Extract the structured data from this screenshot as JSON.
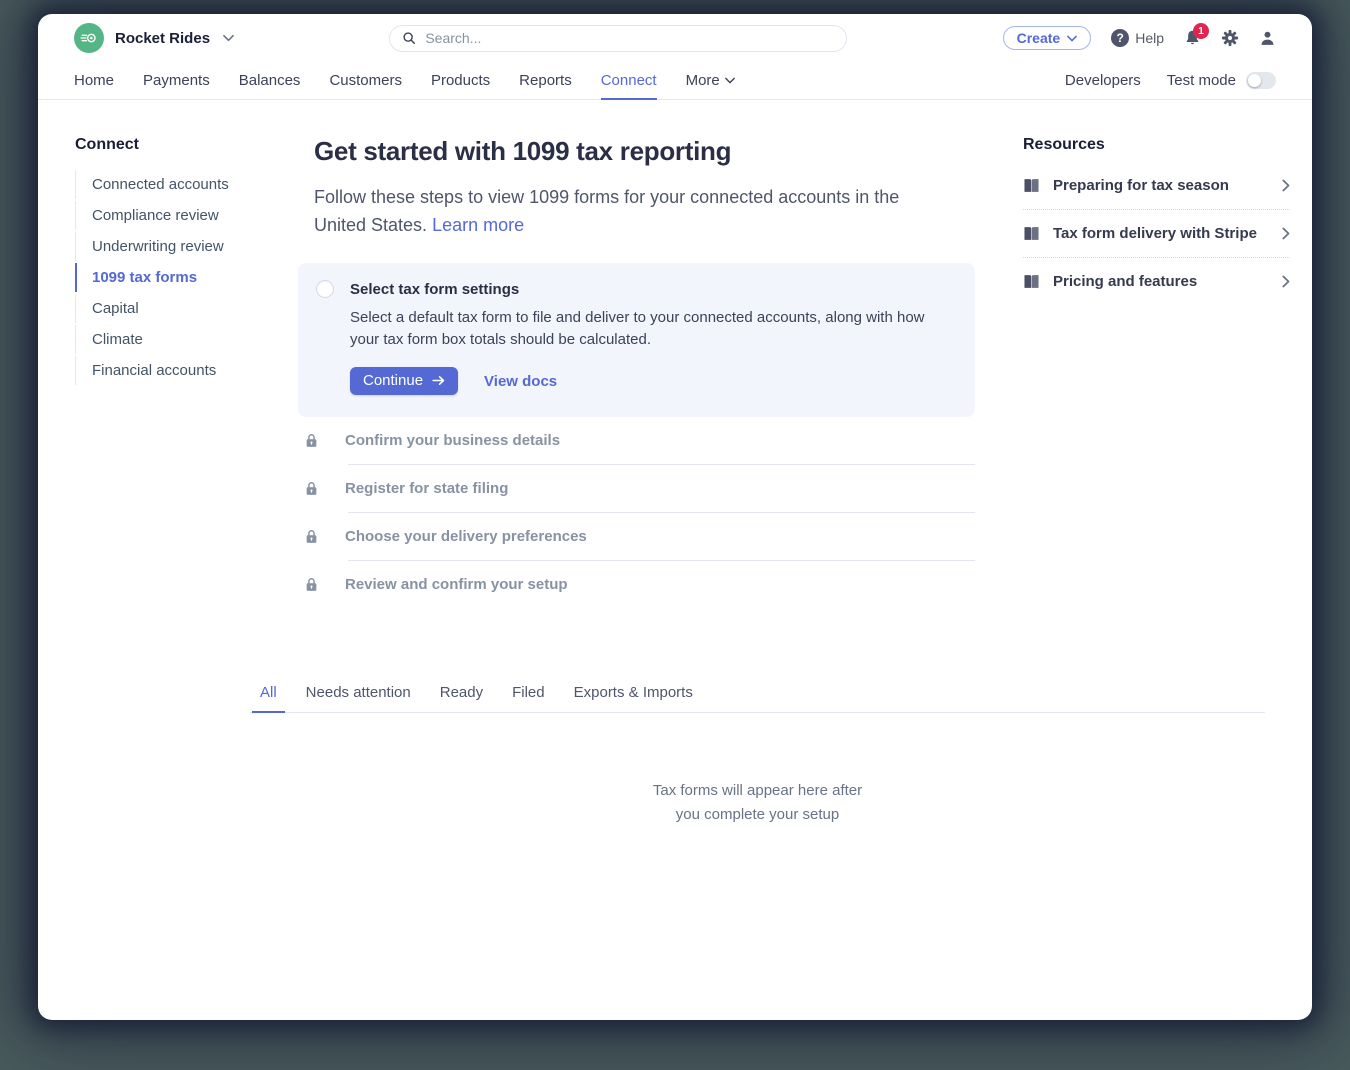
{
  "topbar": {
    "account_name": "Rocket Rides",
    "search_placeholder": "Search...",
    "create_label": "Create",
    "help_label": "Help",
    "notification_count": "1"
  },
  "icons": {
    "help_glyph": "?"
  },
  "nav": {
    "items": [
      {
        "label": "Home"
      },
      {
        "label": "Payments"
      },
      {
        "label": "Balances"
      },
      {
        "label": "Customers"
      },
      {
        "label": "Products"
      },
      {
        "label": "Reports"
      },
      {
        "label": "Connect"
      },
      {
        "label": "More"
      }
    ],
    "active": "Connect",
    "developers_label": "Developers",
    "test_mode_label": "Test mode",
    "test_mode_on": false
  },
  "sidebar": {
    "title": "Connect",
    "items": [
      {
        "label": "Connected accounts",
        "active": false
      },
      {
        "label": "Compliance review",
        "active": false
      },
      {
        "label": "Underwriting review",
        "active": false
      },
      {
        "label": "1099 tax forms",
        "active": true
      },
      {
        "label": "Capital",
        "active": false
      },
      {
        "label": "Climate",
        "active": false
      },
      {
        "label": "Financial accounts",
        "active": false
      }
    ]
  },
  "main": {
    "title": "Get started with 1099 tax reporting",
    "subtitle": "Follow these steps to view 1099 forms for your connected accounts in the United States.",
    "learn_more_label": "Learn more",
    "active_step": {
      "title": "Select tax form settings",
      "description": "Select a default tax form to file and deliver to your connected accounts, along with how your tax form box totals should be calculated.",
      "continue_label": "Continue",
      "view_docs_label": "View docs"
    },
    "locked_steps": [
      {
        "title": "Confirm your business details"
      },
      {
        "title": "Register for state filing"
      },
      {
        "title": "Choose your delivery preferences"
      },
      {
        "title": "Review and confirm your setup"
      }
    ]
  },
  "tabs": {
    "items": [
      {
        "label": "All"
      },
      {
        "label": "Needs attention"
      },
      {
        "label": "Ready"
      },
      {
        "label": "Filed"
      },
      {
        "label": "Exports & Imports"
      }
    ],
    "active": "All"
  },
  "empty_state": {
    "line1": "Tax forms will appear here after",
    "line2": "you complete your setup"
  },
  "resources": {
    "title": "Resources",
    "items": [
      {
        "label": "Preparing for tax season"
      },
      {
        "label": "Tax form delivery with Stripe"
      },
      {
        "label": "Pricing and features"
      }
    ]
  },
  "colors": {
    "accent": "#5469d4",
    "brand_green": "#55b685",
    "notification_red": "#e0264f",
    "heading_text": "#2a2f45",
    "muted_text": "#8792a2",
    "card_background": "#f2f5fb"
  }
}
